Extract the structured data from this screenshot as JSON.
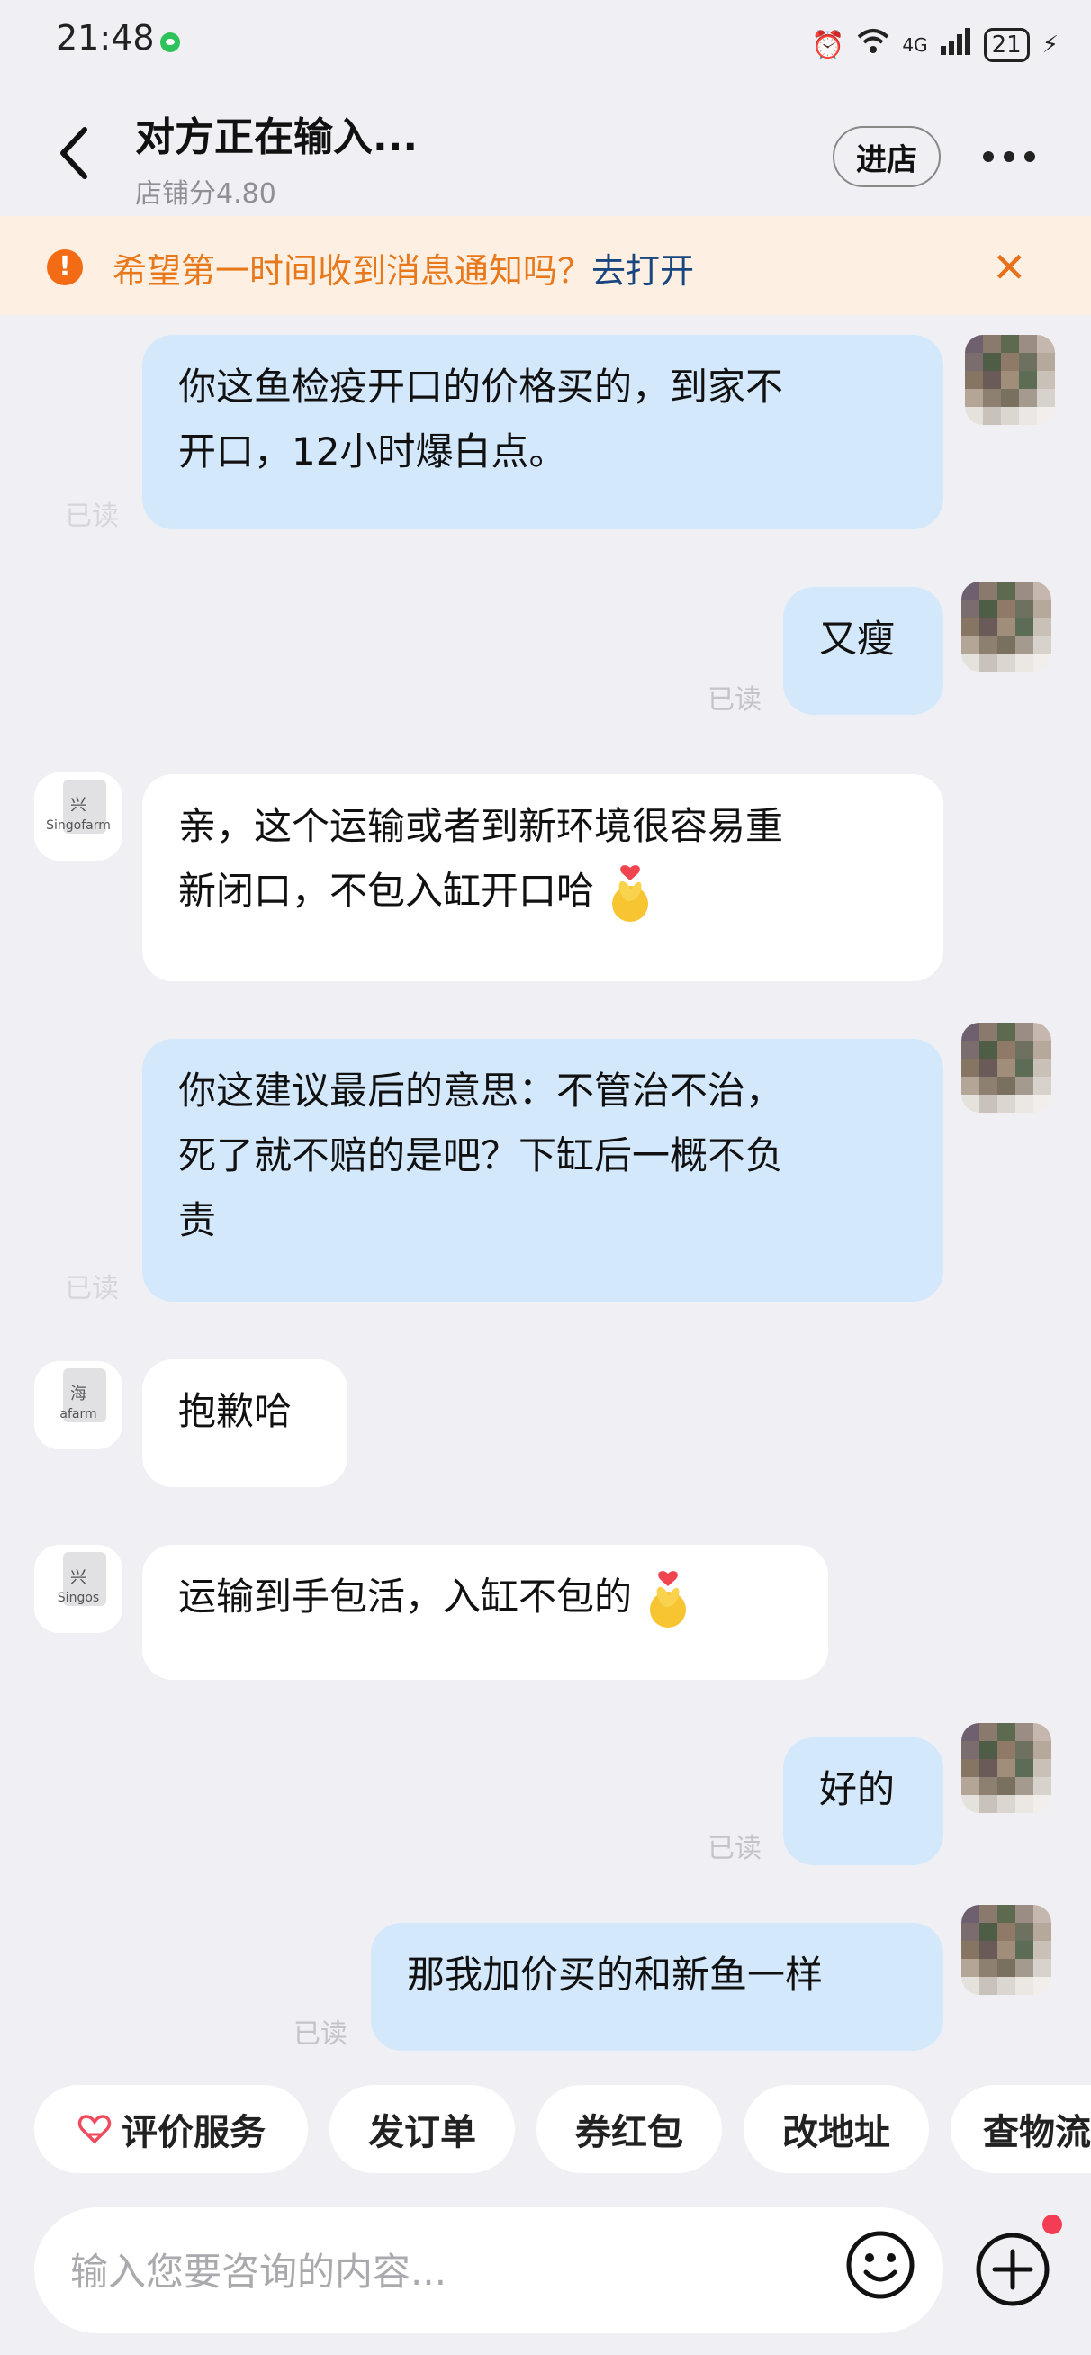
{
  "status_bar": {
    "time": "21:48",
    "network": "4G",
    "battery": "21"
  },
  "header": {
    "title": "对方正在输入...",
    "subtitle": "店铺分4.80",
    "store_button": "进店"
  },
  "banner": {
    "text": "希望第一时间收到消息通知吗？",
    "link": "去打开"
  },
  "messages": [
    {
      "side": "me",
      "lines": [
        "你这鱼检疫开口的价格买的，到家不",
        "开口，12小时爆白点。"
      ],
      "read": "已读"
    },
    {
      "side": "me",
      "lines": [
        "又瘦"
      ],
      "read": "已读"
    },
    {
      "side": "them",
      "lines": [
        "亲，这个运输或者到新环境很容易重",
        "新闭口，不包入缸开口哈"
      ],
      "avatar_text": "Singofarm"
    },
    {
      "side": "me",
      "lines": [
        "你这建议最后的意思：不管治不治，",
        "死了就不赔的是吧？下缸后一概不负",
        "责"
      ],
      "read": "已读"
    },
    {
      "side": "them",
      "lines": [
        "抱歉哈"
      ],
      "avatar_text": "海"
    },
    {
      "side": "them",
      "lines": [
        "运输到手包活，入缸不包的"
      ],
      "avatar_text": "Singos"
    },
    {
      "side": "me",
      "lines": [
        "好的"
      ],
      "read": "已读"
    },
    {
      "side": "me",
      "lines": [
        "那我加价买的和新鱼一样"
      ],
      "read": "已读"
    }
  ],
  "quick_actions": [
    "评价服务",
    "发订单",
    "券红包",
    "改地址",
    "查物流"
  ],
  "input": {
    "placeholder": "输入您要咨询的内容..."
  },
  "colors": {
    "accent_orange": "#e8781c",
    "my_bubble": "#d4e8fb",
    "background": "#f0f0f4"
  }
}
